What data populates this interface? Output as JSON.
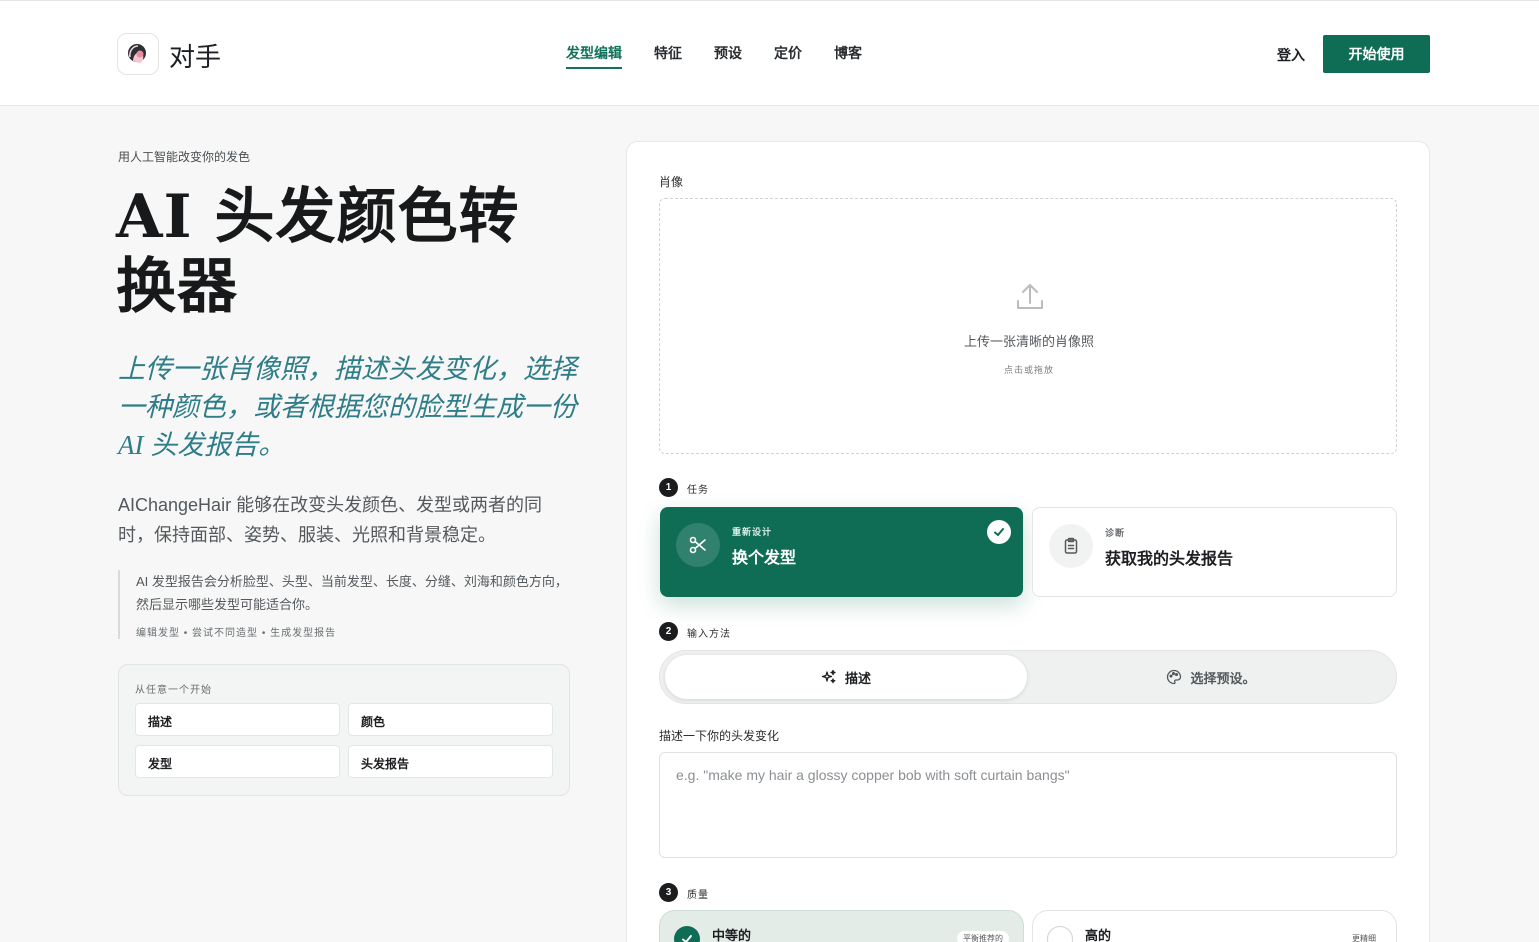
{
  "header": {
    "brand": "对手",
    "nav": [
      "发型编辑",
      "特征",
      "预设",
      "定价",
      "博客"
    ],
    "login": "登入",
    "cta": "开始使用"
  },
  "hero": {
    "eyebrow": "用人工智能改变你的发色",
    "title": "AI 头发颜色转换器",
    "subtitle": "上传一张肖像照，描述头发变化，选择一种颜色，或者根据您的脸型生成一份 AI 头发报告。",
    "description": "AIChangeHair 能够在改变头发颜色、发型或两者的同时，保持面部、姿势、服装、光照和背景稳定。",
    "quote": "AI 发型报告会分析脸型、头型、当前发型、长度、分缝、刘海和颜色方向，然后显示哪些发型可能适合你。",
    "tags": "编辑发型 • 尝试不同造型 • 生成发型报告"
  },
  "starter": {
    "label": "从任意一个开始",
    "chips": [
      "描述",
      "颜色",
      "发型",
      "头发报告"
    ]
  },
  "form": {
    "portrait_label": "肖像",
    "upload_text": "上传一张清晰的肖像照",
    "upload_hint": "点击或拖放",
    "step1": {
      "num": "1",
      "label": "任务"
    },
    "task_selected": {
      "small": "重新设计",
      "big": "换个发型"
    },
    "task_other": {
      "small": "诊断",
      "big": "获取我的头发报告"
    },
    "step2": {
      "num": "2",
      "label": "输入方法"
    },
    "method_describe": "描述",
    "method_preset": "选择预设。",
    "describe_label": "描述一下你的头发变化",
    "describe_placeholder": "e.g. \"make my hair a glossy copper bob with soft curtain bangs\"",
    "step3": {
      "num": "3",
      "label": "质量"
    },
    "quality_medium": "中等的",
    "quality_medium_badge": "平衡推荐的",
    "quality_high": "高的",
    "quality_high_badge": "更精细"
  },
  "colors": {
    "accent": "#0f6d55",
    "hero_subtitle": "#2f7d88"
  }
}
